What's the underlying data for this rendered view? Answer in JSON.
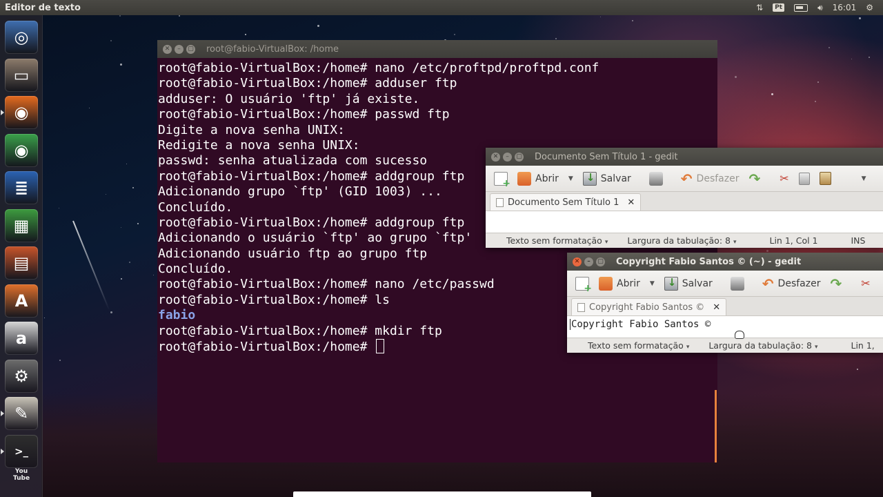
{
  "top_panel": {
    "app_title": "Editor de texto",
    "keyboard_layout": "Pt",
    "clock": "16:01"
  },
  "launcher": {
    "items": [
      {
        "name": "dash-home",
        "glyph": "◎",
        "color": "#3f6fb0"
      },
      {
        "name": "files",
        "glyph": "▭",
        "color": "#8c7b6b"
      },
      {
        "name": "firefox",
        "glyph": "◉",
        "color": "#e66b1f"
      },
      {
        "name": "chrome",
        "glyph": "◉",
        "color": "#3aa04a"
      },
      {
        "name": "writer",
        "glyph": "≣",
        "color": "#2b63b3"
      },
      {
        "name": "calc",
        "glyph": "▦",
        "color": "#3d9b3f"
      },
      {
        "name": "impress",
        "glyph": "▤",
        "color": "#c8542a"
      },
      {
        "name": "software-center",
        "glyph": "A",
        "color": "#e0702b"
      },
      {
        "name": "amazon",
        "glyph": "a",
        "color": "#d6d6d6"
      },
      {
        "name": "system-settings",
        "glyph": "⚙",
        "color": "#6c6c6c"
      },
      {
        "name": "text-editor",
        "glyph": "✎",
        "color": "#c9c4b8"
      },
      {
        "name": "terminal",
        "glyph": ">_",
        "color": "#2e2e2e"
      }
    ],
    "youtube_label": "You Tube"
  },
  "terminal": {
    "title": "root@fabio-VirtualBox: /home",
    "lines": [
      "root@fabio-VirtualBox:/home# nano /etc/proftpd/proftpd.conf",
      "root@fabio-VirtualBox:/home# adduser ftp",
      "adduser: O usuário 'ftp' já existe.",
      "root@fabio-VirtualBox:/home# passwd ftp",
      "Digite a nova senha UNIX:",
      "Redigite a nova senha UNIX:",
      "passwd: senha atualizada com sucesso",
      "root@fabio-VirtualBox:/home# addgroup ftp",
      "Adicionando grupo `ftp' (GID 1003) ...",
      "Concluído.",
      "root@fabio-VirtualBox:/home# addgroup ftp",
      "Adicionando o usuário `ftp' ao grupo `ftp'",
      "Adicionando usuário ftp ao grupo ftp",
      "Concluído.",
      "root@fabio-VirtualBox:/home# nano /etc/passwd",
      "root@fabio-VirtualBox:/home# ls"
    ],
    "ls_output": "fabio",
    "lines_after": [
      "root@fabio-VirtualBox:/home# mkdir ftp"
    ],
    "prompt": "root@fabio-VirtualBox:/home# "
  },
  "gedit1": {
    "title": "Documento Sem Título 1 - gedit",
    "toolbar": {
      "open": "Abrir",
      "save": "Salvar",
      "undo": "Desfazer"
    },
    "tab": "Documento Sem Título 1",
    "content": "",
    "status": {
      "format": "Texto sem formatação",
      "tab_width": "Largura da tabulação: 8",
      "position": "Lin 1, Col 1",
      "mode": "INS"
    }
  },
  "gedit2": {
    "title": "Copyright Fabio Santos © (~) - gedit",
    "toolbar": {
      "open": "Abrir",
      "save": "Salvar",
      "undo": "Desfazer"
    },
    "tab": "Copyright Fabio Santos ©",
    "content": "Copyright Fabio Santos ©",
    "status": {
      "format": "Texto sem formatação",
      "tab_width": "Largura da tabulação: 8",
      "position": "Lin 1,"
    }
  }
}
